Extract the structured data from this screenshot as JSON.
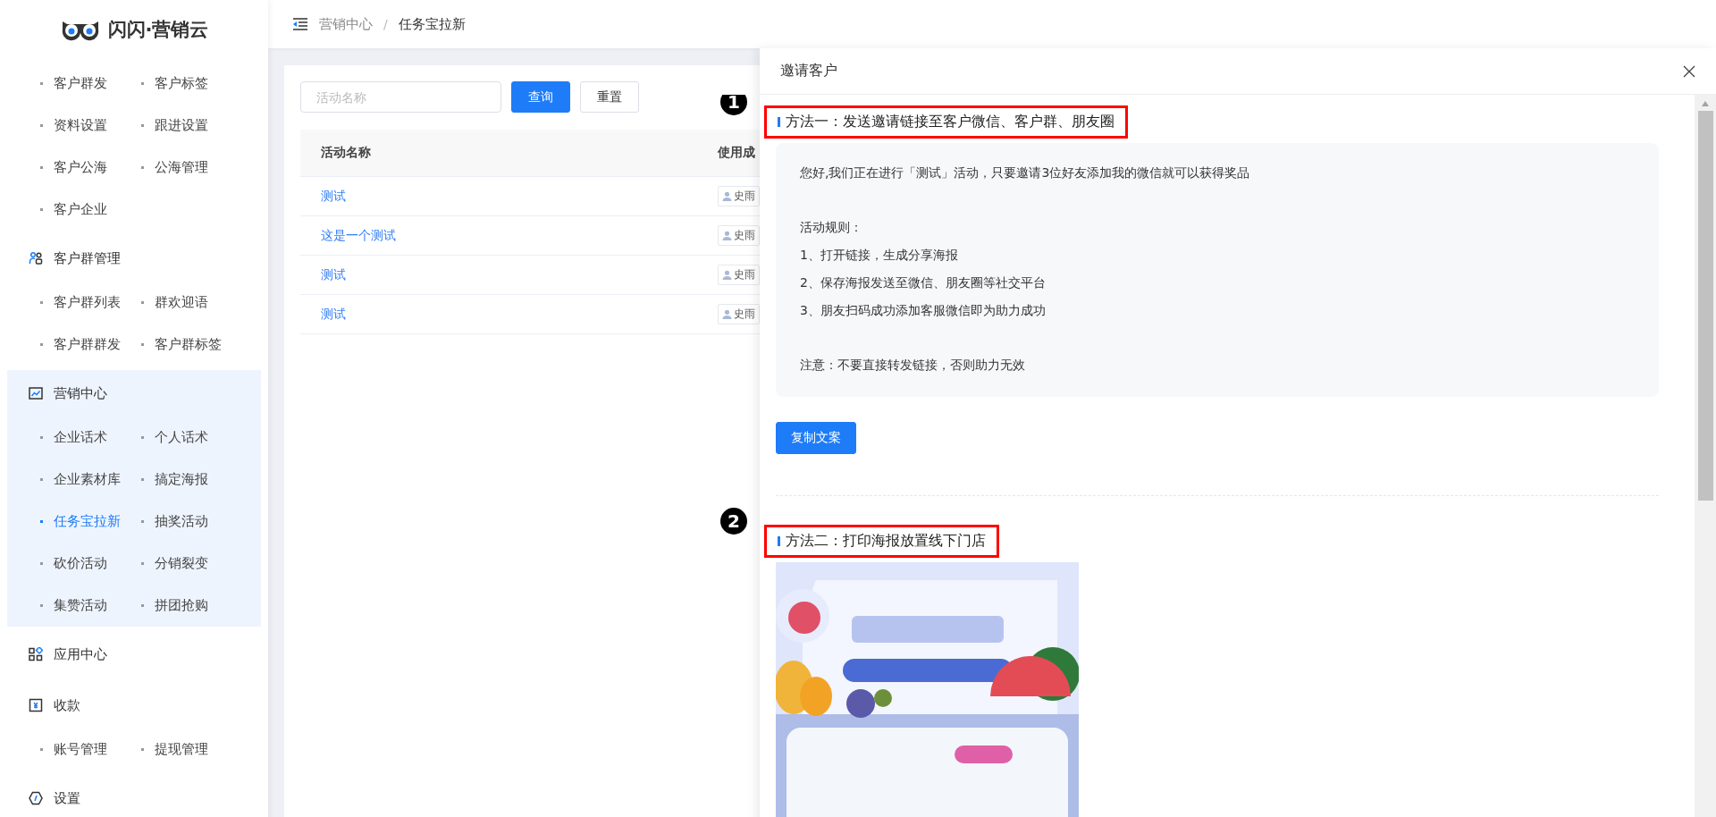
{
  "sidebar": {
    "logo": "闪闪·营销云",
    "groups": [
      {
        "items": [
          {
            "label": "客户群发",
            "selected": false
          },
          {
            "label": "客户标签",
            "selected": false
          },
          {
            "label": "资料设置",
            "selected": false
          },
          {
            "label": "跟进设置",
            "selected": false
          },
          {
            "label": "客户公海",
            "selected": false
          },
          {
            "label": "公海管理",
            "selected": false
          },
          {
            "label": "客户企业",
            "selected": false
          }
        ]
      },
      {
        "title": "客户群管理",
        "kind": "people",
        "active": false,
        "items": [
          {
            "label": "客户群列表",
            "selected": false
          },
          {
            "label": "群欢迎语",
            "selected": false
          },
          {
            "label": "客户群群发",
            "selected": false
          },
          {
            "label": "客户群标签",
            "selected": false
          }
        ]
      },
      {
        "title": "营销中心",
        "kind": "chart",
        "active": true,
        "items": [
          {
            "label": "企业话术",
            "selected": false
          },
          {
            "label": "个人话术",
            "selected": false
          },
          {
            "label": "企业素材库",
            "selected": false
          },
          {
            "label": "搞定海报",
            "selected": false
          },
          {
            "label": "任务宝拉新",
            "selected": true
          },
          {
            "label": "抽奖活动",
            "selected": false
          },
          {
            "label": "砍价活动",
            "selected": false
          },
          {
            "label": "分销裂变",
            "selected": false
          },
          {
            "label": "集赞活动",
            "selected": false
          },
          {
            "label": "拼团抢购",
            "selected": false
          }
        ]
      },
      {
        "title": "应用中心",
        "kind": "apps",
        "active": false
      },
      {
        "title": "收款",
        "kind": "payment",
        "active": false,
        "items": [
          {
            "label": "账号管理",
            "selected": false
          },
          {
            "label": "提现管理",
            "selected": false
          }
        ]
      },
      {
        "title": "设置",
        "kind": "settings",
        "active": false
      }
    ]
  },
  "breadcrumb": {
    "items": [
      "营销中心",
      "任务宝拉新"
    ],
    "separator": "/"
  },
  "filter": {
    "placeholder": "活动名称",
    "buttons": [
      {
        "label": "查询",
        "kind": "primary"
      },
      {
        "label": "重置",
        "kind": "default"
      }
    ]
  },
  "table": {
    "columns": [
      "活动名称",
      "使用成"
    ],
    "rows": [
      {
        "name": "测试",
        "owner": "史雨"
      },
      {
        "name": "这是一个测试",
        "owner": "史雨"
      },
      {
        "name": "测试",
        "owner": "史雨"
      },
      {
        "name": "测试",
        "owner": "史雨"
      }
    ]
  },
  "drawer": {
    "title": "邀请客户",
    "sections": [
      {
        "badge": "1",
        "title": "方法一：发送邀请链接至客户微信、客户群、朋友圈",
        "highlighted": true,
        "kind": "message",
        "paragraphs": [
          {
            "lines": [
              "您好,我们正在进行「测试」活动，只要邀请3位好友添加我的微信就可以获得奖品"
            ]
          },
          {
            "lines": [
              "活动规则：",
              "1、打开链接，生成分享海报",
              "2、保存海报发送至微信、朋友圈等社交平台",
              "3、朋友扫码成功添加客服微信即为助力成功"
            ]
          },
          {
            "lines": [
              "注意：不要直接转发链接，否则助力无效"
            ]
          }
        ],
        "button": "复制文案"
      },
      {
        "badge": "2",
        "title": "方法二：打印海报放置线下门店",
        "highlighted": true,
        "kind": "poster"
      }
    ]
  }
}
